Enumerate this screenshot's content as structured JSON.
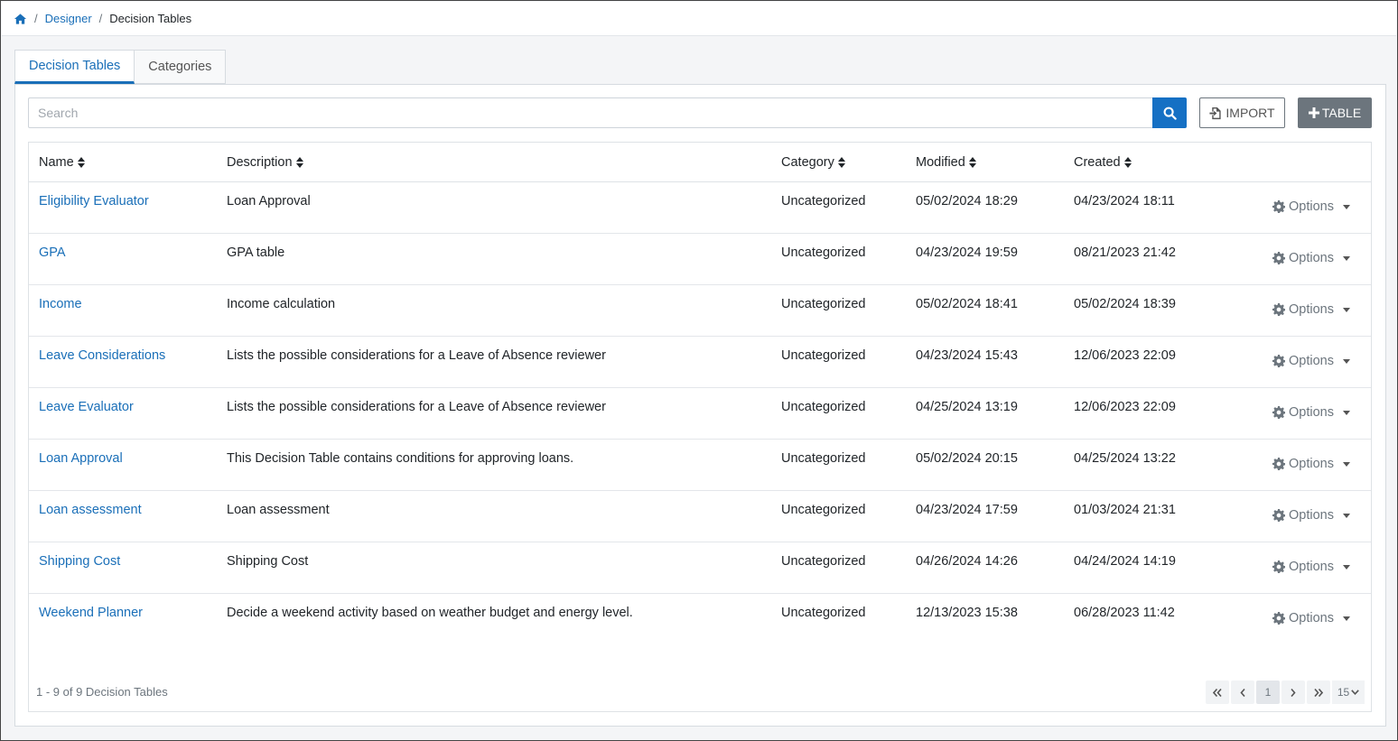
{
  "breadcrumb": {
    "designer": "Designer",
    "current": "Decision Tables"
  },
  "tabs": [
    {
      "label": "Decision Tables",
      "active": true
    },
    {
      "label": "Categories",
      "active": false
    }
  ],
  "search": {
    "placeholder": "Search"
  },
  "toolbar": {
    "import_label": "IMPORT",
    "table_label": "TABLE"
  },
  "columns": {
    "name": "Name",
    "description": "Description",
    "category": "Category",
    "modified": "Modified",
    "created": "Created"
  },
  "rows": [
    {
      "name": "Eligibility Evaluator",
      "description": "Loan Approval",
      "category": "Uncategorized",
      "modified": "05/02/2024 18:29",
      "created": "04/23/2024 18:11",
      "options": "Options"
    },
    {
      "name": "GPA",
      "description": "GPA table",
      "category": "Uncategorized",
      "modified": "04/23/2024 19:59",
      "created": "08/21/2023 21:42",
      "options": "Options"
    },
    {
      "name": "Income",
      "description": "Income calculation",
      "category": "Uncategorized",
      "modified": "05/02/2024 18:41",
      "created": "05/02/2024 18:39",
      "options": "Options"
    },
    {
      "name": "Leave Considerations",
      "description": "Lists the possible considerations for a Leave of Absence reviewer",
      "category": "Uncategorized",
      "modified": "04/23/2024 15:43",
      "created": "12/06/2023 22:09",
      "options": "Options"
    },
    {
      "name": "Leave Evaluator",
      "description": "Lists the possible considerations for a Leave of Absence reviewer",
      "category": "Uncategorized",
      "modified": "04/25/2024 13:19",
      "created": "12/06/2023 22:09",
      "options": "Options"
    },
    {
      "name": "Loan Approval",
      "description": "This Decision Table contains conditions for approving loans.",
      "category": "Uncategorized",
      "modified": "05/02/2024 20:15",
      "created": "04/25/2024 13:22",
      "options": "Options"
    },
    {
      "name": "Loan assessment",
      "description": "Loan assessment",
      "category": "Uncategorized",
      "modified": "04/23/2024 17:59",
      "created": "01/03/2024 21:31",
      "options": "Options"
    },
    {
      "name": "Shipping Cost",
      "description": "Shipping Cost",
      "category": "Uncategorized",
      "modified": "04/26/2024 14:26",
      "created": "04/24/2024 14:19",
      "options": "Options"
    },
    {
      "name": "Weekend Planner",
      "description": "Decide a weekend activity based on weather budget and energy level.",
      "category": "Uncategorized",
      "modified": "12/13/2023 15:38",
      "created": "06/28/2023 11:42",
      "options": "Options"
    }
  ],
  "footer": {
    "summary": "1 - 9 of 9 Decision Tables",
    "current_page": "1",
    "page_size": "15"
  },
  "icons": {
    "home": "home-icon",
    "search": "search-icon",
    "import": "file-import-icon",
    "add": "plus-icon",
    "sort": "sort-icon",
    "options": "gear-icon",
    "caret": "caret-down-icon"
  },
  "colors": {
    "accent": "#1a6fb8",
    "search_button": "#1570c4",
    "secondary_button": "#6c757d"
  }
}
